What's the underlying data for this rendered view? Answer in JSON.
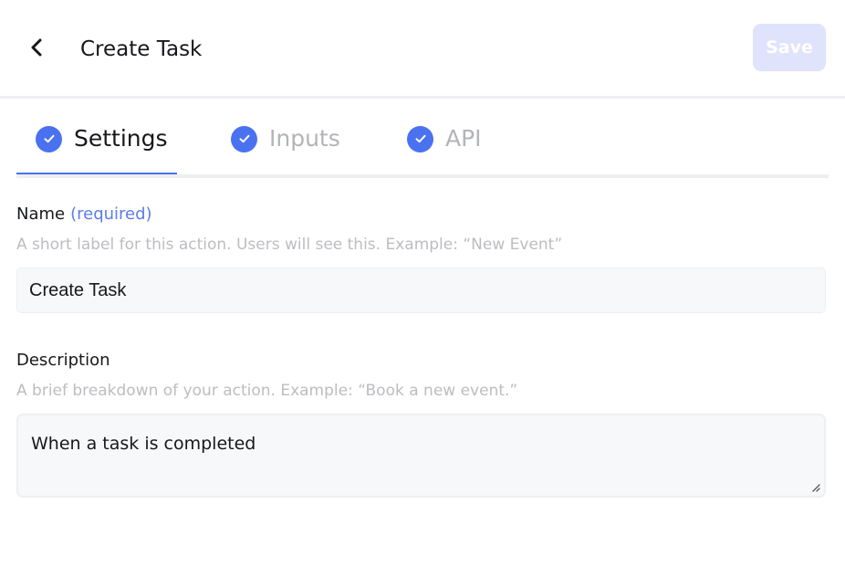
{
  "header": {
    "title": "Create Task",
    "save_label": "Save",
    "back_icon": "chevron-left-icon"
  },
  "tabs": [
    {
      "label": "Settings",
      "state": "active",
      "icon": "check-circle-icon"
    },
    {
      "label": "Inputs",
      "state": "inactive",
      "icon": "check-circle-icon"
    },
    {
      "label": "API",
      "state": "inactive",
      "icon": "check-circle-icon"
    }
  ],
  "form": {
    "name": {
      "label": "Name",
      "required_label": "(required)",
      "helper": "A short label for this action. Users will see this. Example: “New Event”",
      "value": "Create Task"
    },
    "description": {
      "label": "Description",
      "helper": "A brief breakdown of your action. Example: “Book a new event.”",
      "value": "When a task is completed"
    }
  },
  "colors": {
    "accent": "#4a72f0",
    "save_disabled_bg": "#dfe3fb",
    "required_text": "#5b7de8",
    "muted_text": "#b3b4b7"
  }
}
